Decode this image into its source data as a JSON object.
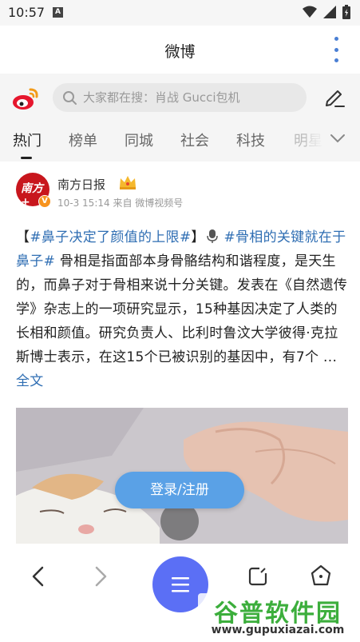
{
  "status_bar": {
    "time": "10:57",
    "notification_letter": "A"
  },
  "header": {
    "title": "微博"
  },
  "search": {
    "placeholder": "大家都在搜：肖战 Gucci包机"
  },
  "tabs": [
    {
      "label": "热门",
      "active": true
    },
    {
      "label": "榜单",
      "active": false
    },
    {
      "label": "同城",
      "active": false
    },
    {
      "label": "社会",
      "active": false
    },
    {
      "label": "科技",
      "active": false
    },
    {
      "label": "明星",
      "active": false
    }
  ],
  "post": {
    "avatar_text": "南方+",
    "author": "南方日报",
    "meta": "10-3 15:14 来自 微博视频号",
    "text": {
      "bracket_open": "【",
      "hashtag1": "#鼻子决定了颜值的上限#",
      "bracket_close": "】",
      "hashtag2": "#骨相的关键就在于鼻子#",
      "body": " 骨相是指面部本身骨骼结构和谐程度，是天生的，而鼻子对于骨相来说十分关键。发表在《自然遗传学》杂志上的一项研究显示，15种基因决定了人类的长相和颜值。研究负责人、比利时鲁汶大学彼得·克拉斯博士表示，在这15个已被识别的基因中，有7个 ...",
      "full_text_link": "全文"
    },
    "media_label": "video thumbnail of a cat"
  },
  "login_button": {
    "label": "登录/注册"
  },
  "watermark": {
    "title": "谷普软件园",
    "url": "www.gupuxiazai.com"
  },
  "colors": {
    "accent": "#5b6ff5",
    "link": "#2f6eb3",
    "login": "#5aa1e6",
    "weibo_red": "#e6162d"
  }
}
